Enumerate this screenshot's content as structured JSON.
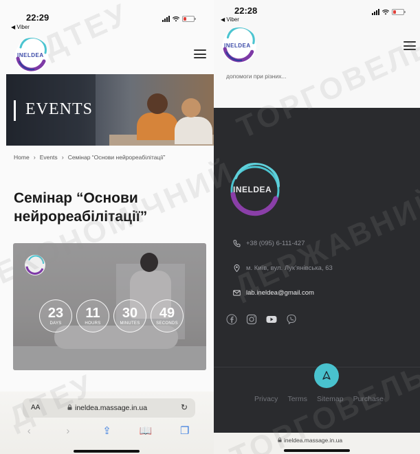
{
  "left_phone": {
    "status": {
      "time": "22:29",
      "back_app": "◀ Viber"
    },
    "logo": {
      "text": "INELDEA"
    },
    "banner": {
      "title": "EVENTS"
    },
    "breadcrumb": {
      "home": "Home",
      "events": "Events",
      "current": "Семінар “Основи нейрореабілітації”",
      "sep": "›"
    },
    "page_title": "Семінар “Основи нейрореабілітації”",
    "countdown": [
      {
        "value": "23",
        "label": "DAYS"
      },
      {
        "value": "11",
        "label": "HOURS"
      },
      {
        "value": "30",
        "label": "MINUTES"
      },
      {
        "value": "49",
        "label": "SECONDS"
      }
    ],
    "safari": {
      "aa": "AA",
      "url": "ineldea.massage.in.ua",
      "reload": "↻",
      "back": "‹",
      "forward": "›",
      "share": "⇪",
      "bookmarks": "📖",
      "tabs": "❐"
    }
  },
  "right_phone": {
    "status": {
      "time": "22:28",
      "back_app": "◀ Viber"
    },
    "logo": {
      "text": "INELDEA"
    },
    "excerpt": "допомоги при різних...",
    "footer": {
      "logo_text": "INELDEA",
      "phone": "+38 (095) 6-111-427",
      "address": "м. Київ, вул. Лук’янівська, 63",
      "email": "lab.ineldea@gmail.com",
      "social": [
        "facebook-icon",
        "instagram-icon",
        "youtube-icon",
        "viber-icon"
      ],
      "links": [
        "Privacy",
        "Terms",
        "Sitemap",
        "Purchase"
      ]
    },
    "url": "ineldea.massage.in.ua"
  },
  "watermark": [
    "ДТЕУ",
    "ТОРГОВЕЛЬНИЙ",
    "ЕКОНОМІЧНИЙ",
    "ДЕРЖАВНИЙ",
    "ДТЕУ",
    "ТОРГОВЕЛЬНИЙ"
  ],
  "colors": {
    "accent": "#49c2ce",
    "brand_purple": "#8a3fa8",
    "brand_blue": "#3b4aa8",
    "footer_bg": "#2a2b2e",
    "link_blue": "#3b7ddf"
  }
}
